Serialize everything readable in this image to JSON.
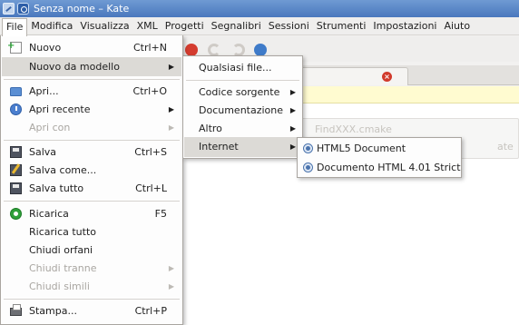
{
  "window": {
    "title": "Senza nome – Kate"
  },
  "menubar": {
    "items": [
      "File",
      "Modifica",
      "Visualizza",
      "XML",
      "Progetti",
      "Segnalibri",
      "Sessioni",
      "Strumenti",
      "Impostazioni",
      "Aiuto"
    ]
  },
  "file_menu": {
    "items": [
      {
        "label": "Nuovo",
        "shortcut": "Ctrl+N",
        "icon": "new-document-icon"
      },
      {
        "label": "Nuovo da modello",
        "submenu": true
      },
      {
        "label": "Apri...",
        "shortcut": "Ctrl+O",
        "icon": "open-folder-icon"
      },
      {
        "label": "Apri recente",
        "submenu": true,
        "icon": "recent-icon"
      },
      {
        "label": "Apri con",
        "submenu": true,
        "disabled": true
      },
      {
        "label": "Salva",
        "shortcut": "Ctrl+S",
        "icon": "save-icon"
      },
      {
        "label": "Salva come...",
        "icon": "save-as-icon"
      },
      {
        "label": "Salva tutto",
        "shortcut": "Ctrl+L",
        "icon": "save-all-icon"
      },
      {
        "label": "Ricarica",
        "shortcut": "F5",
        "icon": "reload-icon"
      },
      {
        "label": "Ricarica tutto"
      },
      {
        "label": "Chiudi orfani"
      },
      {
        "label": "Chiudi tranne",
        "submenu": true,
        "disabled": true
      },
      {
        "label": "Chiudi simili",
        "submenu": true,
        "disabled": true
      },
      {
        "label": "Stampa...",
        "shortcut": "Ctrl+P",
        "icon": "print-icon"
      }
    ]
  },
  "template_submenu": {
    "items": [
      "Qualsiasi file...",
      "Codice sorgente",
      "Documentazione",
      "Altro",
      "Internet"
    ]
  },
  "internet_submenu": {
    "items": [
      "HTML5 Document",
      "Documento HTML 4.01 Strict"
    ]
  },
  "background": {
    "ghost_text_1": "FindXXX.cmake",
    "ghost_text_2": "ate"
  },
  "colors": {
    "titlebar": "#4a78bd",
    "highlight": "#dcdad6",
    "infobar": "#fffbd0"
  }
}
